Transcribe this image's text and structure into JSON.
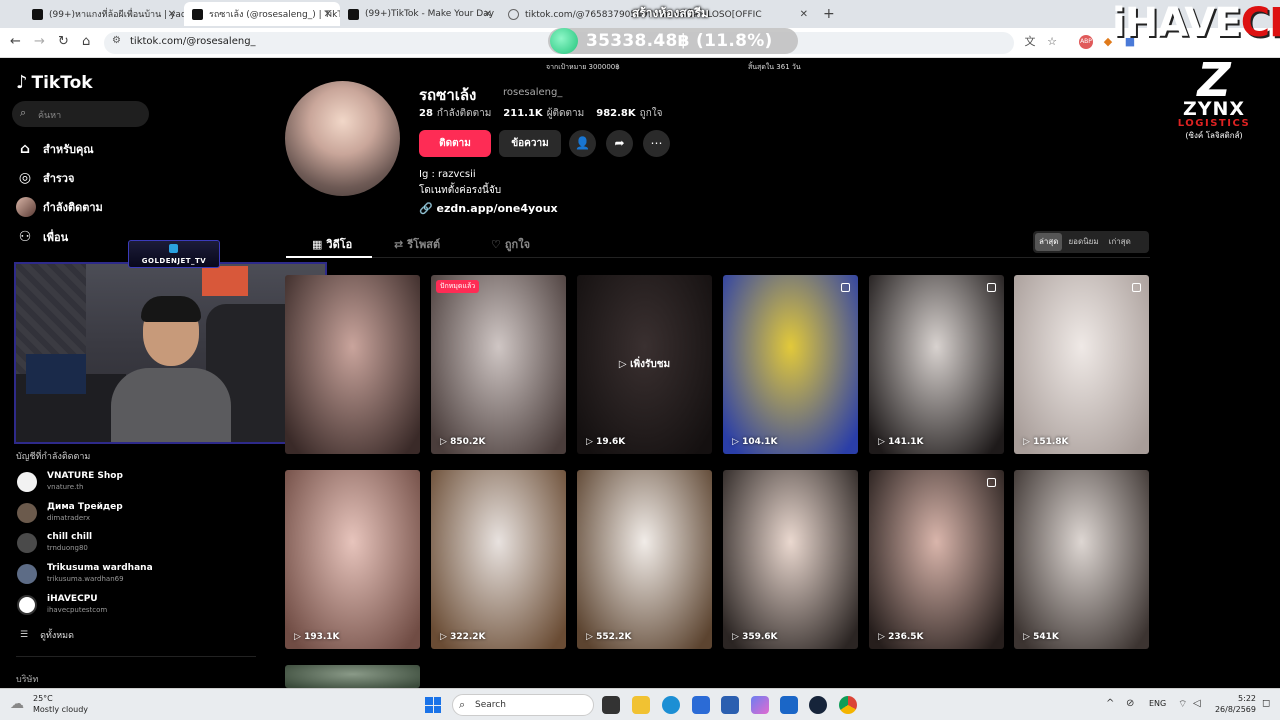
{
  "browser": {
    "tabs": [
      {
        "title": "(99+)หาแกงที่ล้อผีเพื่อนบ้าน | yadai",
        "icon": "tiktok-icon"
      },
      {
        "title": "รถซาเล้ง (@rosesaleng_) | TikTok",
        "icon": "tiktok-icon",
        "active": true
      },
      {
        "title": "(99+)TikTok - Make Your Day",
        "icon": "tiktok-icon"
      },
      {
        "title": "tiktok.com/@765837905497...ตนเอกโล - LOSO[OFFIC",
        "icon": "globe-icon"
      }
    ],
    "url": "tiktok.com/@rosesaleng_"
  },
  "overlay": {
    "room_title": "สร้างห้องสตรีม",
    "donation_amount": "35338.48฿ (11.8%)",
    "donation_fraction": 0.118,
    "goal_text": "จากเป้าหมาย 300000฿",
    "ends_text": "สิ้นสุดใน 361 วัน",
    "brand_left": "iHAVE",
    "brand_right": "CPU",
    "sponsor": {
      "mark": "Z",
      "name": "ZYNX",
      "sub": "LOGISTICS",
      "thai": "(ซิงค์ โลจิสติกส์)"
    },
    "cam_label": "GOLDENJET_TV"
  },
  "sidebar": {
    "logo": "TikTok",
    "search_placeholder": "ค้นหา",
    "nav": [
      {
        "label": "สำหรับคุณ",
        "icon": "home-icon"
      },
      {
        "label": "สำรวจ",
        "icon": "compass-icon"
      },
      {
        "label": "กำลังติดตาม",
        "icon": "avatar"
      },
      {
        "label": "เพื่อน",
        "icon": "friends-icon"
      }
    ],
    "following_heading": "บัญชีที่กำลังติดตาม",
    "accounts": [
      {
        "name": "VNATURE Shop",
        "handle": "vnature.th",
        "color": "#f2f2f2"
      },
      {
        "name": "Дима Трейдер",
        "handle": "dimatraderx",
        "color": "#6b5a4c"
      },
      {
        "name": "chill chill",
        "handle": "trnduong80",
        "color": "#4a4a4a"
      },
      {
        "name": "Trikusuma wardhana",
        "handle": "trikusuma.wardhan69",
        "color": "#5d6c86"
      },
      {
        "name": "iHAVECPU",
        "handle": "ihavecputestcom",
        "color": "#ffffff"
      }
    ],
    "see_all": "ดูทั้งหมด",
    "company": "บริษัท"
  },
  "profile": {
    "display_name": "รถซาเล้ง",
    "username": "rosesaleng_",
    "following_count": "28",
    "following_label": "กำลังติดตาม",
    "followers_count": "211.1K",
    "followers_label": "ผู้ติดตาม",
    "likes_count": "982.8K",
    "likes_label": "ถูกใจ",
    "follow_button": "ติดตาม",
    "message_button": "ข้อความ",
    "bio_line1": "Ig : razvcsii",
    "bio_line2": "โดเนทตั้งค่อรงนี้จับ",
    "link": "ezdn.app/one4youx"
  },
  "tabs": [
    {
      "label": "วิดีโอ",
      "icon": "grid-icon"
    },
    {
      "label": "รีโพสต์",
      "icon": "repost-icon"
    },
    {
      "label": "ถูกใจ",
      "icon": "heart-icon"
    }
  ],
  "sort": [
    "ล่าสุด",
    "ยอดนิยม",
    "เก่าสุด"
  ],
  "videos": [
    {
      "views": "",
      "badge": "",
      "multi": false,
      "c1": "#c9a49c",
      "c2": "#3a2a28"
    },
    {
      "views": "850.2K",
      "badge": "ปักหมุดแล้ว",
      "multi": false,
      "c1": "#cfc6c4",
      "c2": "#4a3d3b"
    },
    {
      "views": "19.6K",
      "badge": "",
      "multi": false,
      "watched": "เพิ่งรับชม",
      "c1": "#3a3030",
      "c2": "#141010"
    },
    {
      "views": "104.1K",
      "badge": "",
      "multi": true,
      "c1": "#e2c93a",
      "c2": "#2a3ea8"
    },
    {
      "views": "141.1K",
      "badge": "",
      "multi": true,
      "c1": "#d8d2cf",
      "c2": "#1e1a1a"
    },
    {
      "views": "151.8K",
      "badge": "",
      "multi": true,
      "c1": "#efe9e6",
      "c2": "#a89d99"
    },
    {
      "views": "193.1K",
      "badge": "",
      "multi": false,
      "c1": "#e7c4bc",
      "c2": "#704c44"
    },
    {
      "views": "322.2K",
      "badge": "",
      "multi": false,
      "c1": "#e8e2df",
      "c2": "#6a4c34"
    },
    {
      "views": "552.2K",
      "badge": "",
      "multi": false,
      "c1": "#f1ece8",
      "c2": "#5c4430"
    },
    {
      "views": "359.6K",
      "badge": "",
      "multi": false,
      "c1": "#ead8cf",
      "c2": "#2b2523"
    },
    {
      "views": "236.5K",
      "badge": "",
      "multi": true,
      "c1": "#d9b5ab",
      "c2": "#261e1c"
    },
    {
      "views": "541K",
      "badge": "",
      "multi": false,
      "c1": "#ddd6d2",
      "c2": "#3c3431"
    },
    {
      "views": "",
      "badge": "",
      "multi": false,
      "c1": "#8a9a88",
      "c2": "#3a4a3a"
    }
  ],
  "taskbar": {
    "temp": "25°C",
    "weather": "Mostly cloudy",
    "search_placeholder": "Search",
    "lang": "ENG",
    "time": "5:22",
    "date": "26/8/2569"
  }
}
